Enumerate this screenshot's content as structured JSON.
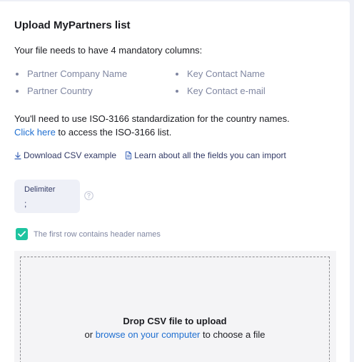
{
  "panel": {
    "title": "Upload MyPartners list",
    "intro": "Your file needs to have 4 mandatory columns:",
    "mandatory_columns": [
      "Partner Company Name",
      "Partner Country",
      "Key Contact Name",
      "Key Contact e-mail"
    ],
    "iso_text": "You'll need to use ISO-3166 standardization for the country names.",
    "iso_link": "Click here",
    "iso_suffix": " to access the ISO-3166 list.",
    "download_csv": "Download CSV example",
    "learn_fields": "Learn about all the fields you can import",
    "delimiter": {
      "label": "Delimiter",
      "value": ";"
    },
    "header_checkbox": {
      "label": "The first row contains header names",
      "checked": true
    },
    "dropzone": {
      "title": "Drop CSV file to upload",
      "prefix": "or ",
      "link": "browse on your computer",
      "suffix": " to choose a file"
    }
  },
  "colors": {
    "accent_link": "#1f6fd1",
    "checkbox": "#1ec4a0",
    "muted_text": "#7f86a1"
  }
}
